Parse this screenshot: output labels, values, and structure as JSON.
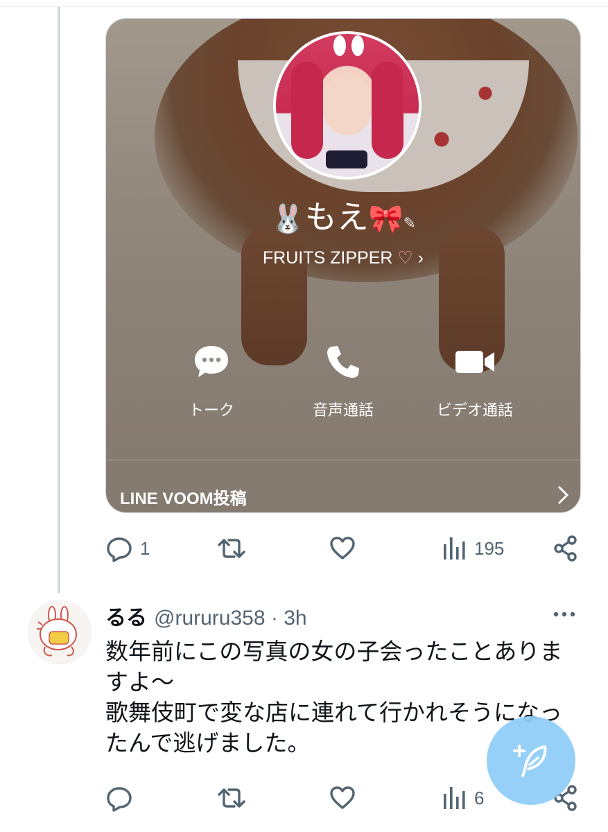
{
  "parent_tweet": {
    "media": {
      "profile_name": "もえ",
      "status_message": "FRUITS ZIPPER",
      "actions": [
        {
          "label": "トーク",
          "icon": "speech-bubble-icon"
        },
        {
          "label": "音声通話",
          "icon": "phone-icon"
        },
        {
          "label": "ビデオ通話",
          "icon": "video-camera-icon"
        }
      ],
      "voom_label": "LINE VOOM投稿"
    },
    "stats": {
      "replies": "1",
      "retweets": "",
      "likes": "",
      "views": "195"
    }
  },
  "reply_tweet": {
    "display_name": "るる",
    "handle_time": "@rururu358 · 3h",
    "text_lines": [
      "数年前にこの写真の女の子会ったことありま",
      "すよ〜",
      "歌舞伎町で変な店に連れて行かれそうになっ",
      "たんで逃げました。"
    ],
    "stats": {
      "replies": "",
      "retweets": "",
      "likes": "",
      "views": "6"
    }
  },
  "colors": {
    "icon_gray": "#536471",
    "fab": "#8ecdf8",
    "text": "#0f1419"
  }
}
